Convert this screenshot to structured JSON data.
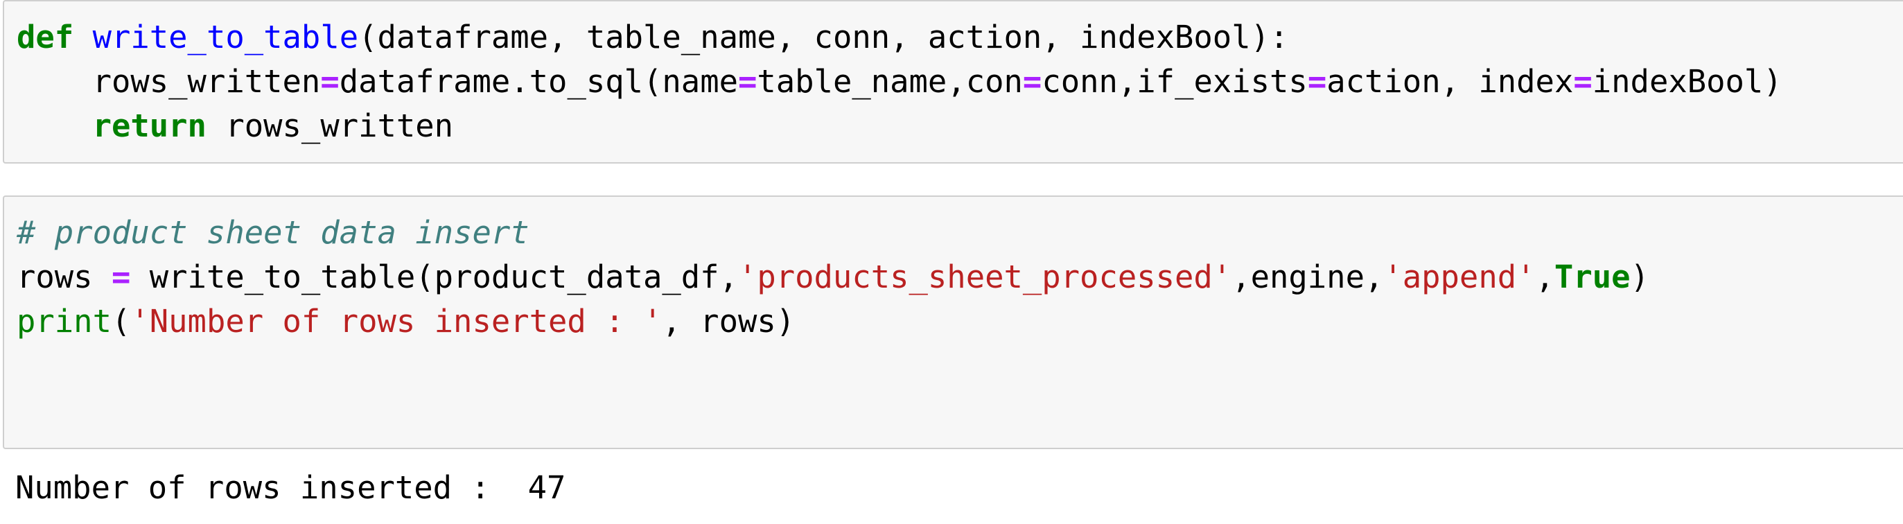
{
  "cell1": {
    "line1": {
      "def_kw": "def",
      "func_name": "write_to_table",
      "params": "(dataframe, table_name, conn, action, indexBool):"
    },
    "line2": {
      "indent": "    ",
      "var": "rows_written",
      "eq1": "=",
      "call": "dataframe.to_sql(name",
      "eq2": "=",
      "arg2": "table_name,con",
      "eq3": "=",
      "arg3": "conn,if_exists",
      "eq4": "=",
      "arg4": "action, index",
      "eq5": "=",
      "arg5": "indexBool)"
    },
    "line3": {
      "indent": "    ",
      "return_kw": "return",
      "rest": " rows_written"
    }
  },
  "cell2": {
    "comment": "# product sheet data insert",
    "line2": {
      "var": "rows ",
      "eq": "=",
      "call": " write_to_table(product_data_df,",
      "str1": "'products_sheet_processed'",
      "sep1": ",engine,",
      "str2": "'append'",
      "sep2": ",",
      "true_kw": "True",
      "close": ")"
    },
    "line3": {
      "print_fn": "print",
      "open": "(",
      "str": "'Number of rows inserted : '",
      "rest": ", rows)"
    }
  },
  "output": {
    "text": "Number of rows inserted :  47"
  },
  "colors": {
    "keyword": "#008000",
    "function": "#0000ff",
    "operator": "#aa22ff",
    "string": "#ba2121",
    "comment": "#408080",
    "cell_background": "#f7f7f7",
    "cell_border": "#cfcfcf"
  }
}
